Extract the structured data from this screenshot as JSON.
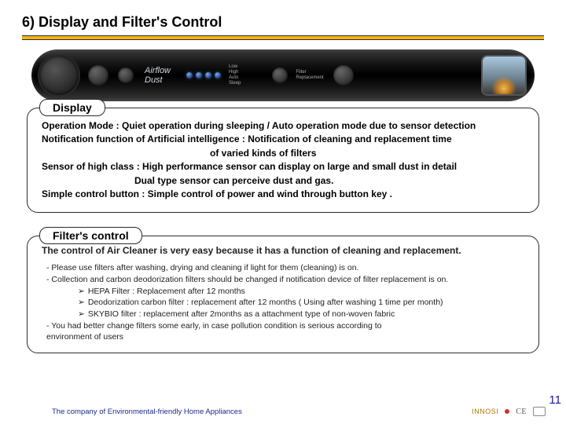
{
  "title": "6) Display and Filter's Control",
  "panel": {
    "airflow_label": "Airflow\nDust",
    "modes_label": "Low\nHigh\nAuto\nSleep",
    "replace_label": "Filter\nReplacement"
  },
  "display": {
    "label": "Display",
    "lines": [
      {
        "b": "Operation Mode  : ",
        "t": "Quiet operation during sleeping  / Auto operation mode due to sensor detection"
      },
      {
        "b": "Notification function of Artificial intelligence : ",
        "t": "Notification of  cleaning and replacement time"
      },
      {
        "indent": "indent1",
        "t": "of varied  kinds of filters"
      },
      {
        "b": "Sensor of  high class  : ",
        "t": "High performance sensor can display on large and small dust in detail"
      },
      {
        "indent": "indent2",
        "t": "Dual type sensor can perceive dust and gas."
      },
      {
        "b": "Simple control button  : ",
        "t": "Simple control of  power and wind through button key ."
      }
    ]
  },
  "filter": {
    "label": "Filter's control",
    "lead": "The control of  Air Cleaner is very easy  because it has a function of cleaning and replacement.",
    "items": [
      "- Please use filters after washing, drying and cleaning if light for them (cleaning) is on.",
      "- Collection and carbon deodorization filters should be changed if notification device of filter replacement is on."
    ],
    "subs": [
      "HEPA Filter : Replacement after 12 months",
      "Deodorization carbon filter : replacement after 12 months ( Using after washing 1 time per month)",
      "SKYBIO filter  : replacement after 2months as a attachment type of  non-woven fabric"
    ],
    "tail": [
      "- You had better change filters some early, in case pollution condition is serious according to",
      "  environment of users"
    ]
  },
  "pagenum": "11",
  "footer": "The company of Environmental-friendly Home Appliances",
  "brand": "INNOSI"
}
